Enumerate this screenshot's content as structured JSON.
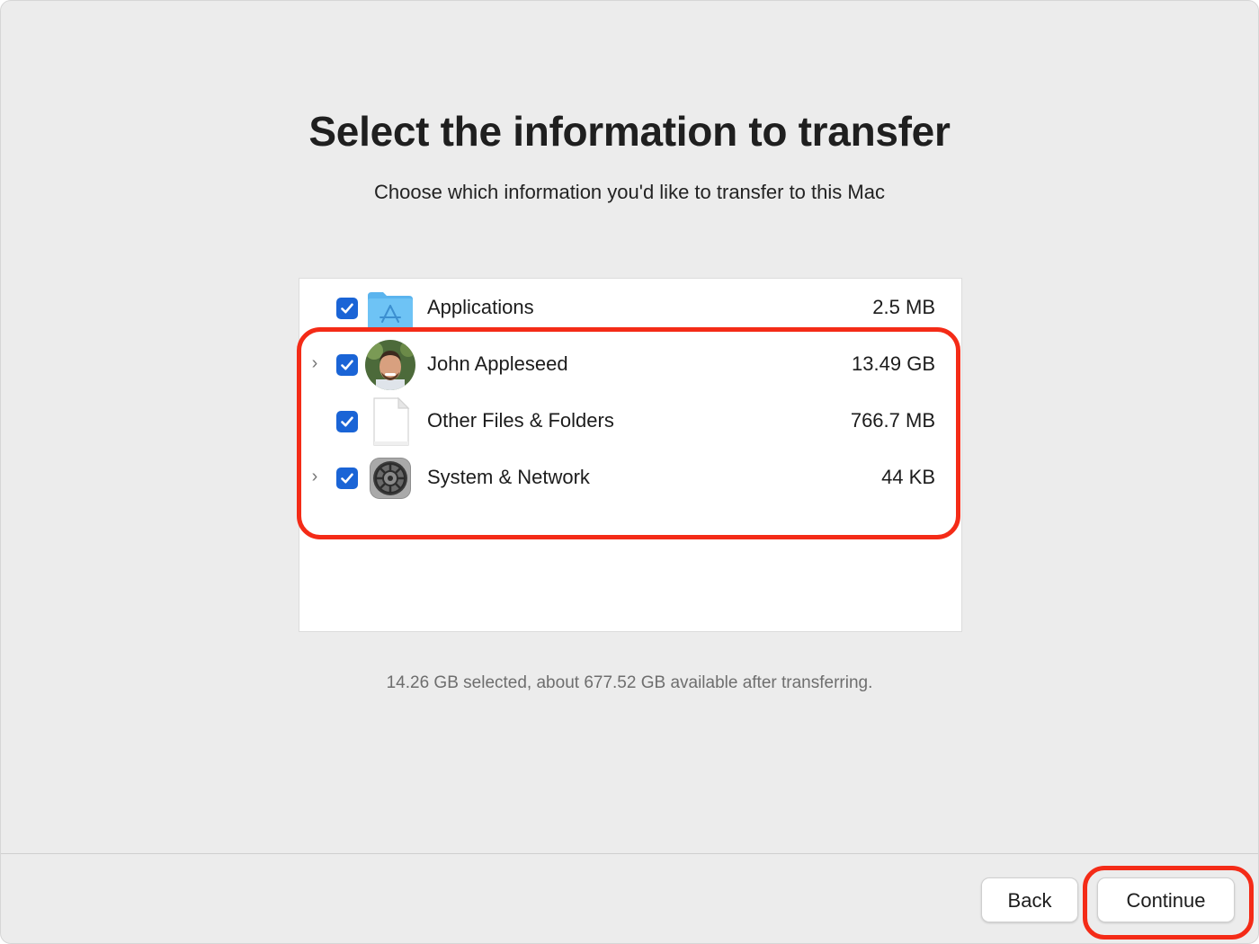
{
  "page": {
    "title": "Select the information to transfer",
    "subtitle": "Choose which information you'd like to transfer to this Mac",
    "status": "14.26 GB selected, about 677.52 GB available after transferring."
  },
  "items": [
    {
      "label": "Applications",
      "size": "2.5 MB",
      "checked": true,
      "expandable": false,
      "icon": "applications-folder-icon"
    },
    {
      "label": "John Appleseed",
      "size": "13.49 GB",
      "checked": true,
      "expandable": true,
      "icon": "user-avatar-icon"
    },
    {
      "label": "Other Files & Folders",
      "size": "766.7 MB",
      "checked": true,
      "expandable": false,
      "icon": "document-icon"
    },
    {
      "label": "System & Network",
      "size": "44 KB",
      "checked": true,
      "expandable": true,
      "icon": "system-settings-gear-icon"
    }
  ],
  "buttons": {
    "back": "Back",
    "continue": "Continue"
  },
  "colors": {
    "accent": "#1a64d6",
    "highlight": "#f42b17",
    "window_bg": "#ececec"
  }
}
